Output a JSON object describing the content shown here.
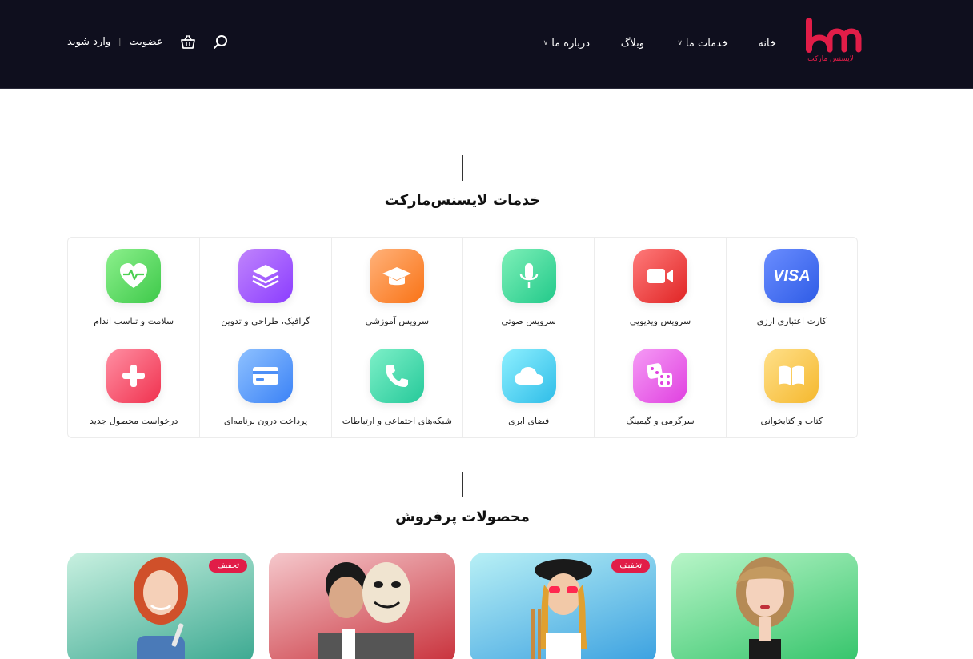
{
  "header": {
    "logo_text": "لایسنس مارکت",
    "nav": [
      {
        "label": "خانه"
      },
      {
        "label": "خدمات ما"
      },
      {
        "label": "وبلاگ"
      },
      {
        "label": "درباره ما"
      }
    ],
    "auth": {
      "register": "عضویت",
      "separator": "|",
      "login": "وارد شوید"
    }
  },
  "services": {
    "title": "خدمات لایسنس‌مارکت",
    "items": [
      {
        "label": "کارت اعتباری ارزی",
        "icon": "visa-card-icon",
        "color": "#3b6ef0"
      },
      {
        "label": "سرویس ویدیویی",
        "icon": "video-camera-icon",
        "color": "#ef4444"
      },
      {
        "label": "سرویس صوتی",
        "icon": "microphone-icon",
        "color": "#34d399"
      },
      {
        "label": "سرویس آموزشی",
        "icon": "graduation-cap-icon",
        "color": "#fb923c"
      },
      {
        "label": "گرافیک، طراحی و تدوین",
        "icon": "layers-icon",
        "color": "#a855f7"
      },
      {
        "label": "سلامت و تناسب اندام",
        "icon": "heart-pulse-icon",
        "color": "#4ade80"
      },
      {
        "label": "کتاب و کتابخوانی",
        "icon": "book-icon",
        "color": "#fbbf24"
      },
      {
        "label": "سرگرمی و گیمینگ",
        "icon": "dice-icon",
        "color": "#e879f9"
      },
      {
        "label": "فضای ابری",
        "icon": "cloud-icon",
        "color": "#38bdf8"
      },
      {
        "label": "شبکه‌های اجتماعی و ارتباطات",
        "icon": "phone-icon",
        "color": "#34d399"
      },
      {
        "label": "پرداخت درون برنامه‌ای",
        "icon": "credit-card-icon",
        "color": "#60a5fa"
      },
      {
        "label": "درخواست محصول جدید",
        "icon": "plus-icon",
        "color": "#f43f5e"
      }
    ],
    "visa_text": "VISA"
  },
  "products": {
    "title": "محصولات پرفروش",
    "badge": "تخفیف"
  }
}
